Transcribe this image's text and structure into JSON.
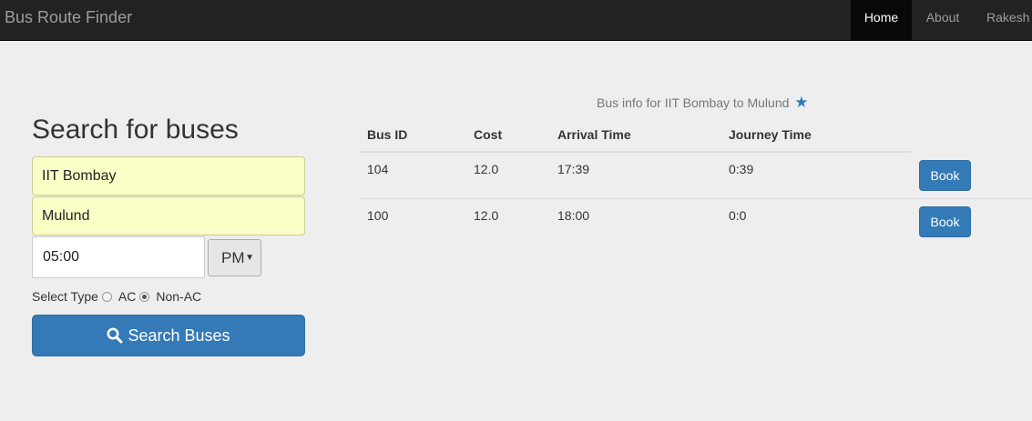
{
  "navbar": {
    "brand": "Bus Route Finder",
    "items": [
      {
        "label": "Home",
        "active": true
      },
      {
        "label": "About",
        "active": false
      },
      {
        "label": "Rakesh",
        "active": false
      }
    ]
  },
  "search": {
    "title": "Search for buses",
    "from_value": "IIT Bombay",
    "to_value": "Mulund",
    "time_value": "05:00",
    "ampm_selected": "PM",
    "type_label": "Select Type",
    "type_options": [
      {
        "label": "AC",
        "checked": false
      },
      {
        "label": "Non-AC",
        "checked": true
      }
    ],
    "button_label": "Search Buses",
    "button_icon": "search-icon"
  },
  "results": {
    "caption": "Bus info for IIT Bombay to Mulund",
    "caption_icon": "star-icon",
    "columns": [
      "Bus ID",
      "Cost",
      "Arrival Time",
      "Journey Time"
    ],
    "rows": [
      {
        "bus_id": "104",
        "cost": "12.0",
        "arrival": "17:39",
        "journey": "0:39",
        "action": "Book"
      },
      {
        "bus_id": "100",
        "cost": "12.0",
        "arrival": "18:00",
        "journey": "0:0",
        "action": "Book"
      }
    ]
  },
  "colors": {
    "navbar_bg": "#222222",
    "primary": "#337ab7",
    "input_highlight": "#fafdc6",
    "page_bg": "#eeeeee"
  }
}
